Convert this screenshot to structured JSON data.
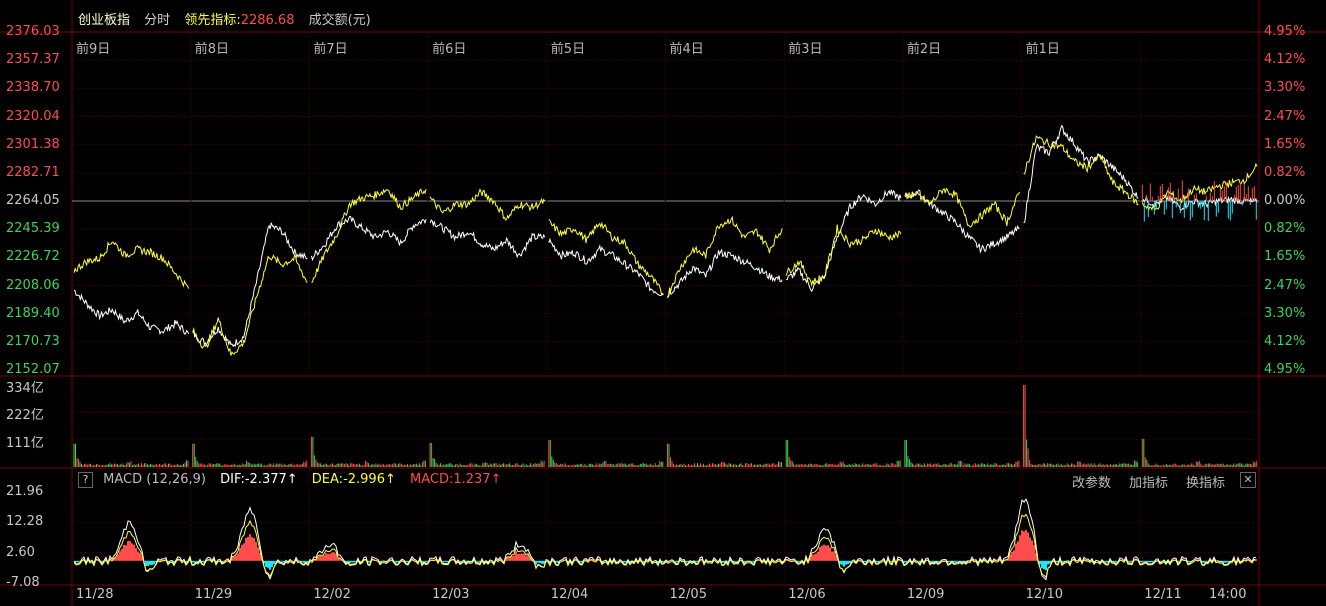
{
  "header": {
    "name": "创业板指",
    "mode": "分时",
    "lead_label": "领先指标:",
    "lead_value": "2286.68",
    "amount_label": "成交额(元)"
  },
  "price_axis": {
    "left": [
      "2376.03",
      "2357.37",
      "2338.70",
      "2320.04",
      "2301.38",
      "2282.71",
      "2264.05",
      "2245.39",
      "2226.72",
      "2208.06",
      "2189.40",
      "2170.73",
      "2152.07"
    ],
    "right": [
      "4.95%",
      "4.12%",
      "3.30%",
      "2.47%",
      "1.65%",
      "0.82%",
      "0.00%",
      "0.82%",
      "1.65%",
      "2.47%",
      "3.30%",
      "4.12%",
      "4.95%"
    ]
  },
  "day_labels": [
    "前9日",
    "前8日",
    "前7日",
    "前6日",
    "前5日",
    "前4日",
    "前3日",
    "前2日",
    "前1日"
  ],
  "volume_axis": [
    "334亿",
    "222亿",
    "111亿"
  ],
  "macd_bar": {
    "help": "?",
    "title": "MACD (12,26,9)",
    "dif": "DIF:-2.377↑",
    "dea": "DEA:-2.996↑",
    "macd": "MACD:1.237↑",
    "btn_params": "改参数",
    "btn_add": "加指标",
    "btn_switch": "换指标",
    "btn_close": "✕"
  },
  "macd_axis": [
    "21.96",
    "12.28",
    "2.60",
    "-7.08"
  ],
  "x_labels": [
    "11/28",
    "11/29",
    "12/02",
    "12/03",
    "12/04",
    "12/05",
    "12/06",
    "12/09",
    "12/10",
    "12/11",
    "14:00"
  ],
  "colors": {
    "price_line": "#ffffff",
    "lead_line": "#ffff33",
    "up": "#ff4d4d",
    "down": "#3cd45a",
    "cyan": "#19e6ff",
    "grid": "#3a0000"
  },
  "chart_data": {
    "type": "line",
    "title": "创业板指 分时",
    "base_price": 2264.05,
    "ylim": [
      2152.07,
      2376.03
    ],
    "sessions": [
      "11/28",
      "11/29",
      "12/02",
      "12/03",
      "12/04",
      "12/05",
      "12/06",
      "12/09",
      "12/10",
      "12/11"
    ],
    "series": [
      {
        "name": "创业板指",
        "points": [
          [
            2205,
            2196,
            2188,
            2192,
            2184,
            2190,
            2180,
            2178,
            2183,
            2176
          ],
          [
            2176,
            2170,
            2180,
            2168,
            2174,
            2210,
            2248,
            2244,
            2230,
            2226
          ],
          [
            2226,
            2235,
            2248,
            2252,
            2246,
            2240,
            2244,
            2236,
            2248,
            2252
          ],
          [
            2252,
            2246,
            2240,
            2244,
            2236,
            2232,
            2238,
            2228,
            2240,
            2240
          ],
          [
            2238,
            2228,
            2230,
            2224,
            2232,
            2228,
            2222,
            2216,
            2206,
            2202
          ],
          [
            2202,
            2210,
            2220,
            2214,
            2230,
            2228,
            2224,
            2220,
            2214,
            2212
          ],
          [
            2212,
            2218,
            2206,
            2214,
            2240,
            2260,
            2268,
            2262,
            2270,
            2266
          ],
          [
            2266,
            2270,
            2262,
            2256,
            2250,
            2240,
            2232,
            2236,
            2240,
            2246
          ],
          [
            2248,
            2300,
            2296,
            2312,
            2302,
            2290,
            2294,
            2286,
            2278,
            2266
          ],
          [
            2266,
            2262,
            2266,
            2260,
            2264,
            2262,
            2264,
            2265,
            2264,
            2263
          ]
        ]
      },
      {
        "name": "领先指标",
        "points": [
          [
            2218,
            2224,
            2226,
            2238,
            2228,
            2232,
            2230,
            2226,
            2216,
            2206
          ],
          [
            2178,
            2166,
            2186,
            2162,
            2170,
            2200,
            2228,
            2222,
            2226,
            2210
          ],
          [
            2210,
            2228,
            2242,
            2262,
            2266,
            2268,
            2272,
            2260,
            2266,
            2272
          ],
          [
            2266,
            2256,
            2262,
            2262,
            2270,
            2264,
            2252,
            2262,
            2260,
            2264
          ],
          [
            2250,
            2242,
            2246,
            2238,
            2250,
            2240,
            2236,
            2222,
            2214,
            2202
          ],
          [
            2202,
            2220,
            2232,
            2228,
            2248,
            2252,
            2240,
            2244,
            2232,
            2246
          ],
          [
            2216,
            2224,
            2210,
            2214,
            2246,
            2236,
            2238,
            2245,
            2240,
            2242
          ],
          [
            2268,
            2268,
            2262,
            2272,
            2268,
            2248,
            2254,
            2262,
            2250,
            2270
          ],
          [
            2282,
            2306,
            2302,
            2300,
            2290,
            2286,
            2294,
            2276,
            2270,
            2262
          ],
          [
            2262,
            2258,
            2270,
            2264,
            2272,
            2270,
            2274,
            2276,
            2278,
            2287
          ]
        ]
      }
    ],
    "volume": {
      "unit": "亿",
      "ylim": [
        0,
        334
      ],
      "session_open_peaks": [
        95,
        95,
        123,
        98,
        110,
        95,
        110,
        110,
        334,
        115
      ]
    },
    "macd": {
      "ylim": [
        -7.08,
        21.96
      ],
      "dif": -2.377,
      "dea": -2.996,
      "macd": 1.237
    }
  }
}
